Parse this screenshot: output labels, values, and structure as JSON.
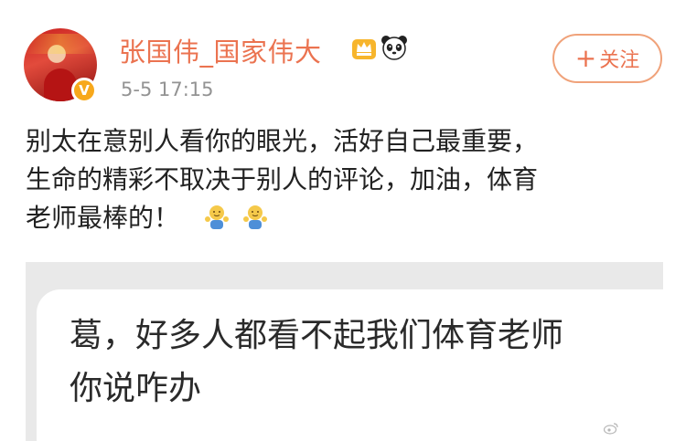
{
  "post": {
    "author": "张国伟_国家伟大",
    "timestamp": "5-5 17:15",
    "follow_label": "关注",
    "text_lines": [
      "别太在意别人看你的眼光，活好自己最重要，",
      "生命的精彩不取决于别人的评论，加油，体育",
      "老师最棒的！"
    ],
    "emoji_icons": [
      "waving-person-emoji",
      "waving-person-emoji"
    ]
  },
  "embedded_image": {
    "chat_lines": [
      "葛，好多人都看不起我们体育老师",
      "你说咋办"
    ]
  },
  "icons": {
    "verified_badge": "v-badge",
    "crown": "crown-icon",
    "panda": "panda-icon",
    "plus": "plus-icon"
  },
  "colors": {
    "username": "#eb7350",
    "follow_border": "#f0a27a",
    "timestamp": "#939393",
    "text": "#222222",
    "badge": "#f7a81b"
  }
}
